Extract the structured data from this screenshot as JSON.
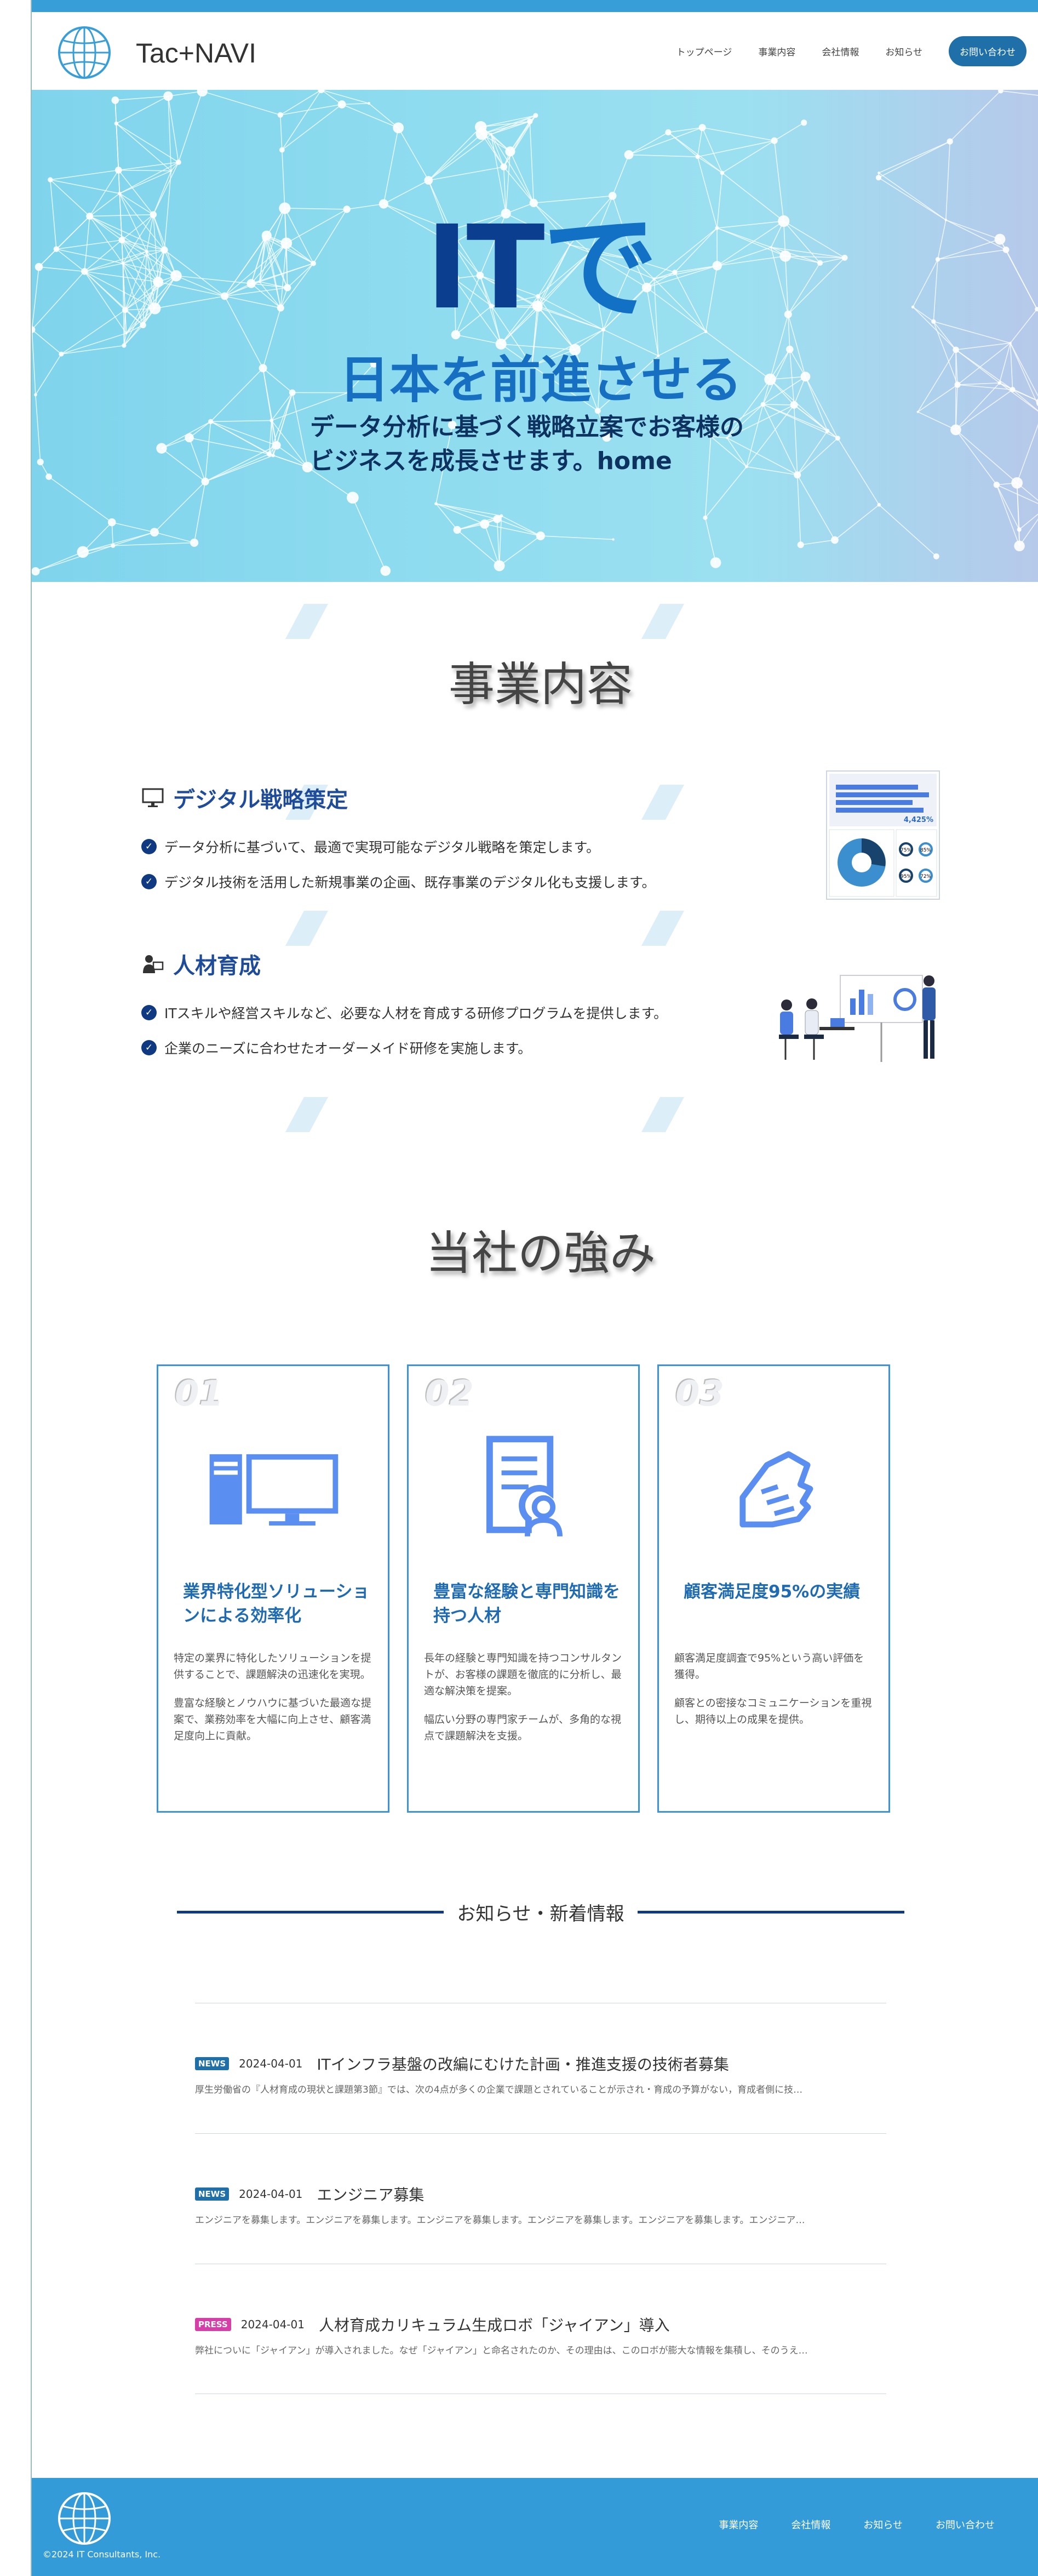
{
  "header": {
    "logo_text": "Tac+NAVI",
    "nav": [
      "トップページ",
      "事業内容",
      "会社情報",
      "お知らせ"
    ],
    "cta": "お問い合わせ"
  },
  "hero": {
    "title_it": "IT",
    "title_de": "で",
    "subtitle": "日本を前進させる",
    "desc_line1": "データ分析に基づく戦略立案でお客様の",
    "desc_line2": "ビジネスを成長させます。home"
  },
  "business": {
    "title": "事業内容",
    "services": [
      {
        "icon": "monitor-icon",
        "name": "デジタル戦略策定",
        "points": [
          "データ分析に基づいて、最適で実現可能なデジタル戦略を策定します。",
          "デジタル技術を活用した新規事業の企画、既存事業のデジタル化も支援します。"
        ],
        "figure_value": "4,425%",
        "donut_values": [
          "75%",
          "85%",
          "95%",
          "72%"
        ]
      },
      {
        "icon": "person-chalkboard-icon",
        "name": "人材育成",
        "points": [
          "ITスキルや経営スキルなど、必要な人材を育成する研修プログラムを提供します。",
          "企業のニーズに合わせたオーダーメイド研修を実施します。"
        ]
      }
    ]
  },
  "strengths": {
    "title": "当社の強み",
    "cards": [
      {
        "num": "01",
        "icon": "computer-icon",
        "title": "業界特化型ソリューションによる効率化",
        "p1": "特定の業界に特化したソリューションを提供することで、課題解決の迅速化を実現。",
        "p2": "豊富な経験とノウハウに基づいた最適な提案で、業務効率を大幅に向上させ、顧客満足度向上に貢献。"
      },
      {
        "num": "02",
        "icon": "resume-icon",
        "title": "豊富な経験と専門知識を持つ人材",
        "p1": "長年の経験と専門知識を持つコンサルタントが、お客様の課題を徹底的に分析し、最適な解決策を提案。",
        "p2": "幅広い分野の専門家チームが、多角的な視点で課題解決を支援。"
      },
      {
        "num": "03",
        "icon": "handshake-icon",
        "title": "顧客満足度95%の実績",
        "p1": "顧客満足度調査で95%という高い評価を獲得。",
        "p2": "顧客との密接なコミュニケーションを重視し、期待以上の成果を提供。"
      }
    ]
  },
  "news": {
    "title": "お知らせ・新着情報",
    "items": [
      {
        "badge": "NEWS",
        "badge_color": "#1f6fa8",
        "date": "2024-04-01",
        "title": "ITインフラ基盤の改編にむけた計画・推進支援の技術者募集",
        "excerpt": "厚生労働省の『人材育成の現状と課題第3節』では、次の4点が多くの企業で課題とされていることが示され・育成の予算がない，育成者側に技…"
      },
      {
        "badge": "NEWS",
        "badge_color": "#1f6fa8",
        "date": "2024-04-01",
        "title": "エンジニア募集",
        "excerpt": "エンジニアを募集します。エンジニアを募集します。エンジニアを募集します。エンジニアを募集します。エンジニアを募集します。エンジニア…"
      },
      {
        "badge": "PRESS",
        "badge_color": "#d63fa8",
        "date": "2024-04-01",
        "title": "人材育成カリキュラム生成ロボ「ジャイアン」導入",
        "excerpt": "弊社についに「ジャイアン」が導入されました。なぜ「ジャイアン」と命名されたのか、その理由は、このロボが膨大な情報を集積し、そのうえ…"
      }
    ]
  },
  "footer": {
    "nav": [
      "事業内容",
      "会社情報",
      "お知らせ",
      "お問い合わせ"
    ],
    "copyright": "©2024 IT Consultants, Inc."
  },
  "colors": {
    "brand_blue": "#379ed7",
    "navy": "#0f3a82",
    "press_pink": "#d63fa8"
  }
}
